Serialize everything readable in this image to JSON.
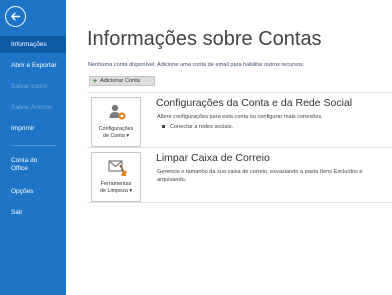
{
  "sidebar": {
    "items": [
      {
        "label": "Informações",
        "state": "active"
      },
      {
        "label": "Abrir e Exportar",
        "state": "normal"
      },
      {
        "label": "Salvar como",
        "state": "disabled"
      },
      {
        "label": "Salvar Anexos",
        "state": "disabled"
      },
      {
        "label": "Imprimir",
        "state": "normal"
      },
      {
        "label": "Conta do Office",
        "state": "normal"
      },
      {
        "label": "Opções",
        "state": "normal"
      },
      {
        "label": "Sair",
        "state": "normal"
      }
    ]
  },
  "main": {
    "title": "Informações sobre Contas",
    "info_text": "Nenhuma conta disponível. Adicione uma conta de email para habilitar outros recursos.",
    "add_account_label": "Adicionar Conta",
    "sections": [
      {
        "button_label_1": "Configurações",
        "button_label_2": "de Conta ▾",
        "title": "Configurações da Conta e da Rede Social",
        "description": "Altere configurações para esta conta ou configurar mais conexões.",
        "bullet": "Conectar a redes sociais."
      },
      {
        "button_label_1": "Ferramentas",
        "button_label_2": "de Limpeza ▾",
        "title": "Limpar Caixa de Correio",
        "description": "Gerencie o tamanho da sua caixa de correio, esvaziando a pasta Itens Excluídos e arquivando."
      }
    ]
  },
  "colors": {
    "sidebar": "#1e74c6",
    "sidebar_active": "#0c5aa6",
    "icon_accent": "#e8822a"
  }
}
